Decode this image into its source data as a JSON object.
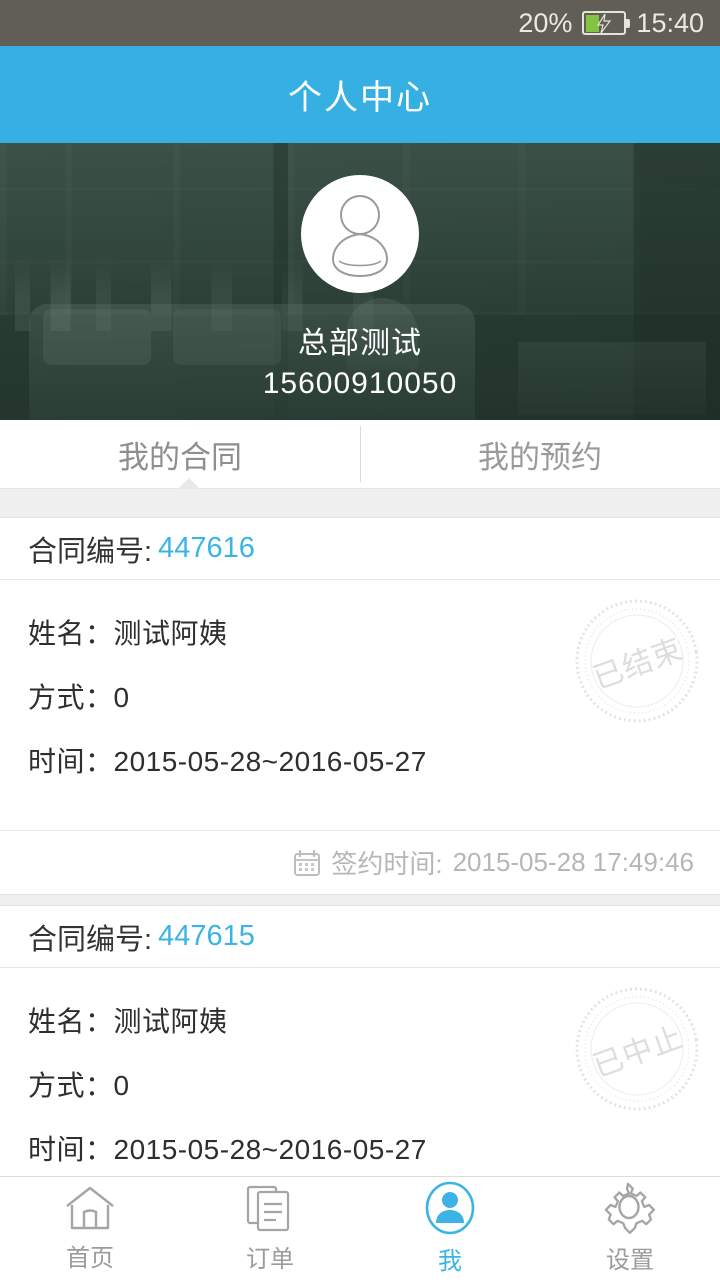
{
  "status_bar": {
    "battery_percent": "20%",
    "battery_icon": "battery-charging-icon",
    "time": "15:40",
    "background_color": "#605e55",
    "battery_fill_color": "#84c442"
  },
  "header": {
    "title": "个人中心",
    "background_color": "#36b0e2",
    "text_color": "#ffffff"
  },
  "profile": {
    "avatar_icon": "person-outline-icon",
    "name": "总部测试",
    "phone": "15600910050"
  },
  "tabs": {
    "items": [
      {
        "label": "我的合同",
        "active": true
      },
      {
        "label": "我的预约",
        "active": false
      }
    ]
  },
  "contracts": [
    {
      "number_label": "合同编号:",
      "number": "447616",
      "name_row": "姓名：测试阿姨",
      "method_row": "方式：0",
      "time_row": "时间：2015-05-28~2016-05-27",
      "stamp_text": "已结束",
      "sign_icon": "calendar-icon",
      "sign_label": "签约时间:",
      "sign_time": "2015-05-28 17:49:46"
    },
    {
      "number_label": "合同编号:",
      "number": "447615",
      "name_row": "姓名：测试阿姨",
      "method_row": "方式：0",
      "time_row": "时间：2015-05-28~2016-05-27",
      "stamp_text": "已中止"
    }
  ],
  "bottom_nav": {
    "items": [
      {
        "label": "首页",
        "icon": "home-icon",
        "active": false
      },
      {
        "label": "订单",
        "icon": "documents-icon",
        "active": false
      },
      {
        "label": "我",
        "icon": "person-circle-icon",
        "active": true
      },
      {
        "label": "设置",
        "icon": "gear-icon",
        "active": false
      }
    ],
    "active_color": "#3bb4e5",
    "inactive_color": "#9b9b9b"
  }
}
